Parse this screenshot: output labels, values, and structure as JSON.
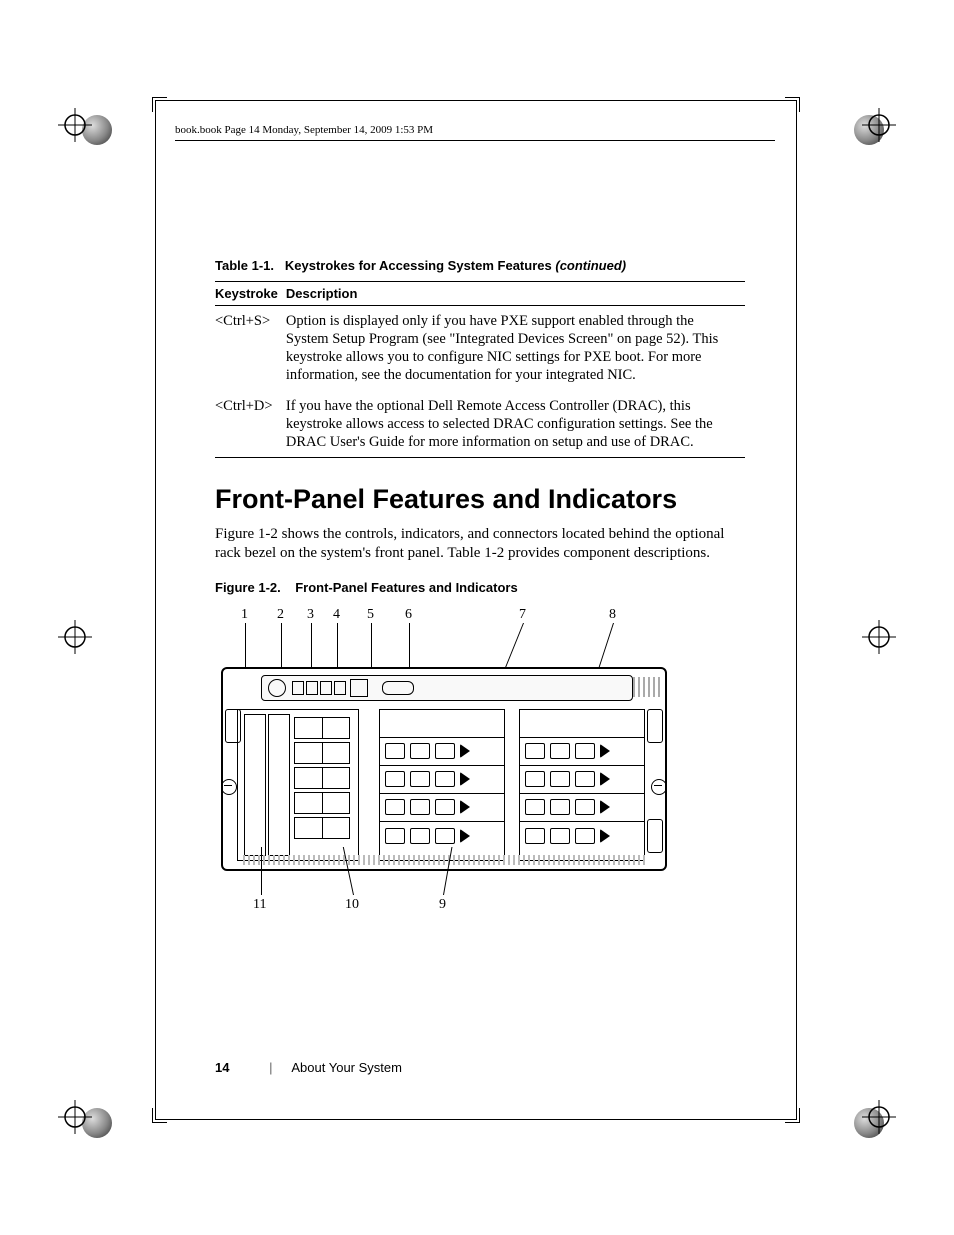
{
  "header_running": "book.book  Page 14  Monday, September 14, 2009  1:53 PM",
  "table": {
    "caption_prefix": "Table 1-1.",
    "caption_title": "Keystrokes for Accessing System Features",
    "caption_suffix": "(continued)",
    "columns": [
      "Keystroke",
      "Description"
    ],
    "rows": [
      {
        "keystroke": "<Ctrl+S>",
        "description": "Option is displayed only if you have PXE support enabled through the System Setup Program (see \"Integrated Devices Screen\" on page 52). This keystroke allows you to configure NIC settings for PXE boot. For more information, see the documentation for your integrated NIC."
      },
      {
        "keystroke": "<Ctrl+D>",
        "description": "If you have the optional Dell Remote Access Controller (DRAC), this keystroke allows access to selected DRAC configuration settings. See the DRAC User's Guide for more information on setup and use of DRAC."
      }
    ]
  },
  "section_heading": "Front-Panel Features and Indicators",
  "section_body": "Figure 1-2 shows the controls, indicators, and connectors located behind the optional rack bezel on the system's front panel. Table 1-2 provides component descriptions.",
  "figure": {
    "caption_prefix": "Figure 1-2.",
    "caption_title": "Front-Panel Features and Indicators",
    "callouts_top": [
      "1",
      "2",
      "3",
      "4",
      "5",
      "6",
      "7",
      "8"
    ],
    "callouts_bottom": [
      "11",
      "10",
      "9"
    ]
  },
  "footer": {
    "page_number": "14",
    "section": "About Your System"
  }
}
